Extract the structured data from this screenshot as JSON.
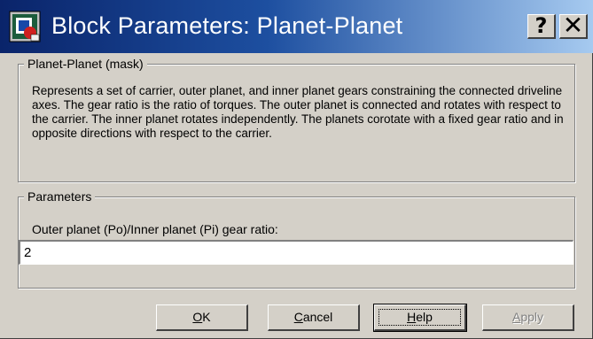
{
  "window": {
    "title": "Block Parameters: Planet-Planet",
    "help_glyph": "?",
    "close_glyph": "✕"
  },
  "mask_group": {
    "legend": "Planet-Planet (mask)",
    "description": "Represents a set of carrier, outer planet, and inner planet gears constraining the connected driveline axes. The gear ratio is the ratio of torques. The outer planet is connected and rotates with respect to the carrier. The inner planet rotates independently. The planets corotate with a fixed gear ratio and in opposite directions with respect to the carrier."
  },
  "params_group": {
    "legend": "Parameters",
    "ratio_label": "Outer planet (Po)/Inner planet (Pi) gear ratio:",
    "ratio_value": "2"
  },
  "buttons": {
    "ok": {
      "mnemonic": "O",
      "rest": "K"
    },
    "cancel": {
      "mnemonic": "C",
      "rest": "ancel"
    },
    "help": {
      "mnemonic": "H",
      "rest": "elp"
    },
    "apply": {
      "mnemonic": "A",
      "rest": "pply",
      "enabled": false
    }
  },
  "icons": {
    "app": "simulink-block-icon",
    "help": "question-mark-icon",
    "close": "close-icon"
  },
  "colors": {
    "titlebar_start": "#0a246a",
    "titlebar_end": "#a6caf0",
    "dialog_face": "#d4d0c8"
  }
}
